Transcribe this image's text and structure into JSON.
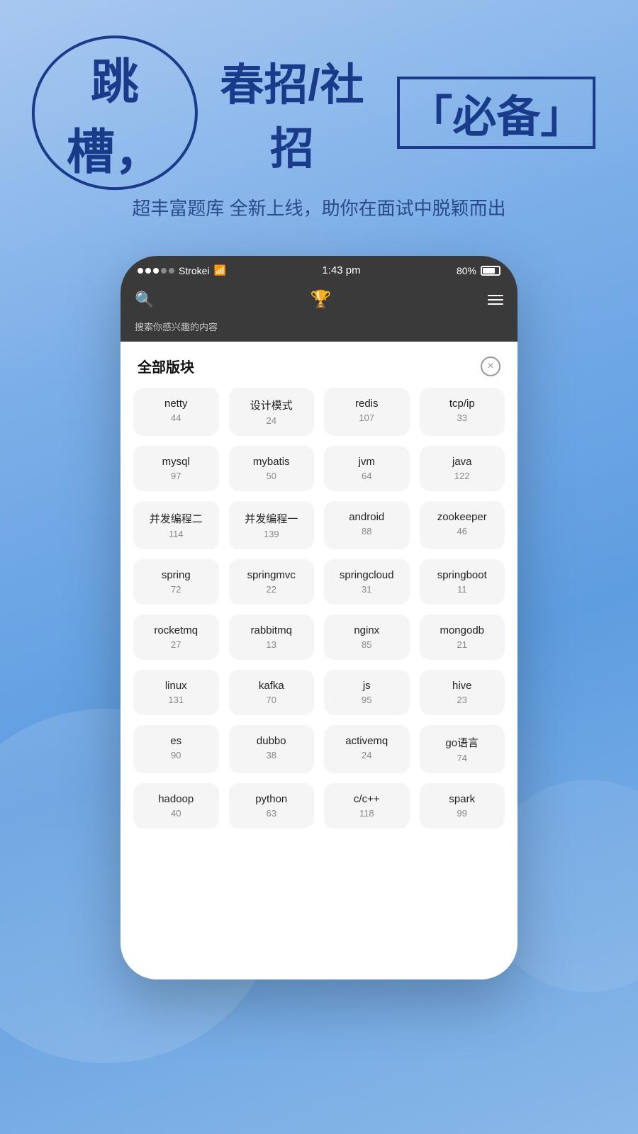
{
  "background": {
    "gradient_start": "#a8c8f0",
    "gradient_end": "#7aaee8"
  },
  "header": {
    "title_main": "跳槽，",
    "title_secondary": "春招/社招",
    "title_badge": "「必备」",
    "subtitle": "超丰富题库 全新上线，助你在面试中脱颖而出"
  },
  "status_bar": {
    "carrier": "Strokei",
    "time": "1:43 pm",
    "battery": "80%"
  },
  "nav": {
    "search_placeholder": "搜索",
    "subtitle": "搜索你感兴趣的内容"
  },
  "section": {
    "title": "全部版块",
    "close_label": "×"
  },
  "grid_items": [
    {
      "name": "netty",
      "count": "44"
    },
    {
      "name": "设计模式",
      "count": "24"
    },
    {
      "name": "redis",
      "count": "107"
    },
    {
      "name": "tcp/ip",
      "count": "33"
    },
    {
      "name": "mysql",
      "count": "97"
    },
    {
      "name": "mybatis",
      "count": "50"
    },
    {
      "name": "jvm",
      "count": "64"
    },
    {
      "name": "java",
      "count": "122"
    },
    {
      "name": "并发编程二",
      "count": "114"
    },
    {
      "name": "并发编程一",
      "count": "139"
    },
    {
      "name": "android",
      "count": "88"
    },
    {
      "name": "zookeeper",
      "count": "46"
    },
    {
      "name": "spring",
      "count": "72"
    },
    {
      "name": "springmvc",
      "count": "22"
    },
    {
      "name": "springcloud",
      "count": "31"
    },
    {
      "name": "springboot",
      "count": "11"
    },
    {
      "name": "rocketmq",
      "count": "27"
    },
    {
      "name": "rabbitmq",
      "count": "13"
    },
    {
      "name": "nginx",
      "count": "85"
    },
    {
      "name": "mongodb",
      "count": "21"
    },
    {
      "name": "linux",
      "count": "131"
    },
    {
      "name": "kafka",
      "count": "70"
    },
    {
      "name": "js",
      "count": "95"
    },
    {
      "name": "hive",
      "count": "23"
    },
    {
      "name": "es",
      "count": "90"
    },
    {
      "name": "dubbo",
      "count": "38"
    },
    {
      "name": "activemq",
      "count": "24"
    },
    {
      "name": "go语言",
      "count": "74"
    },
    {
      "name": "hadoop",
      "count": "40"
    },
    {
      "name": "python",
      "count": "63"
    },
    {
      "name": "c/c++",
      "count": "118"
    },
    {
      "name": "spark",
      "count": "99"
    }
  ]
}
